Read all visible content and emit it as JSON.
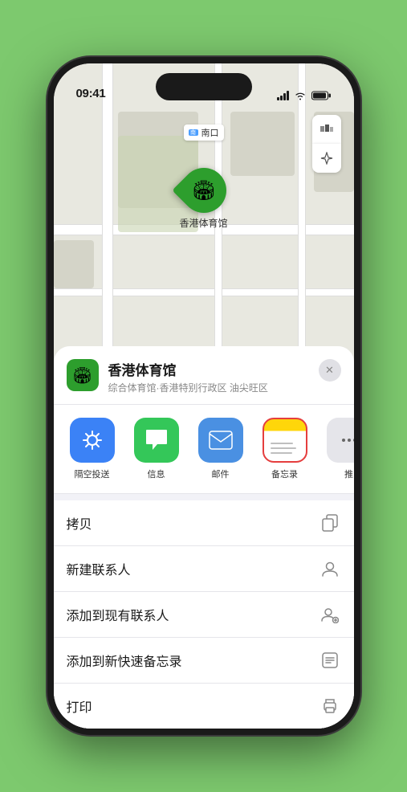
{
  "status_bar": {
    "time": "09:41",
    "signal_label": "signal",
    "wifi_label": "wifi",
    "battery_label": "battery"
  },
  "map": {
    "label_text": "南口",
    "location_name": "香港体育馆",
    "controls": {
      "map_type_icon": "🗺",
      "location_icon": "➤"
    }
  },
  "venue_sheet": {
    "venue_name": "香港体育馆",
    "venue_desc": "综合体育馆·香港特别行政区 油尖旺区",
    "close_icon": "✕"
  },
  "share_apps": [
    {
      "id": "airdrop",
      "label": "隔空投送",
      "icon_type": "airdrop"
    },
    {
      "id": "messages",
      "label": "信息",
      "icon_type": "messages"
    },
    {
      "id": "mail",
      "label": "邮件",
      "icon_type": "mail"
    },
    {
      "id": "notes",
      "label": "备忘录",
      "icon_type": "notes"
    },
    {
      "id": "more",
      "label": "推",
      "icon_type": "more"
    }
  ],
  "actions": [
    {
      "id": "copy",
      "label": "拷贝",
      "icon": "copy"
    },
    {
      "id": "new-contact",
      "label": "新建联系人",
      "icon": "person"
    },
    {
      "id": "add-existing",
      "label": "添加到现有联系人",
      "icon": "person-add"
    },
    {
      "id": "add-notes",
      "label": "添加到新快速备忘录",
      "icon": "note"
    },
    {
      "id": "print",
      "label": "打印",
      "icon": "printer"
    }
  ]
}
